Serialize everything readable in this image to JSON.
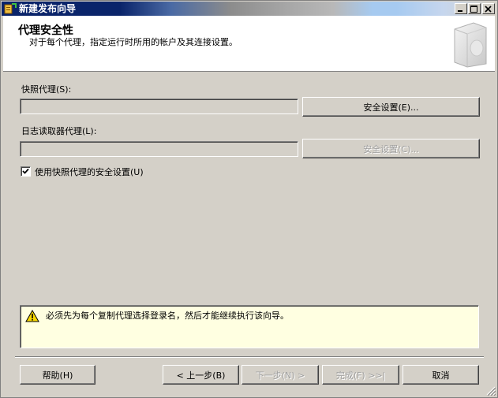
{
  "window": {
    "title": "新建发布向导"
  },
  "header": {
    "title": "代理安全性",
    "subtitle": "对于每个代理，指定运行时所用的帐户及其连接设置。"
  },
  "snapshot_agent": {
    "label": "快照代理(S):",
    "value": "",
    "button": "安全设置(E)..."
  },
  "logreader_agent": {
    "label": "日志读取器代理(L):",
    "value": "",
    "button": "安全设置(C)..."
  },
  "use_snapshot_security": {
    "label": "使用快照代理的安全设置(U)",
    "checked": true
  },
  "message": {
    "text": "必须先为每个复制代理选择登录名，然后才能继续执行该向导。"
  },
  "footer": {
    "help": "帮助(H)",
    "back": "< 上一步(B)",
    "next": "下一步(N) >",
    "finish": "完成(F) >>|",
    "cancel": "取消"
  },
  "colors": {
    "titlebar": "#0a246a",
    "face": "#d4d0c8",
    "info_bg": "#ffffe1"
  }
}
